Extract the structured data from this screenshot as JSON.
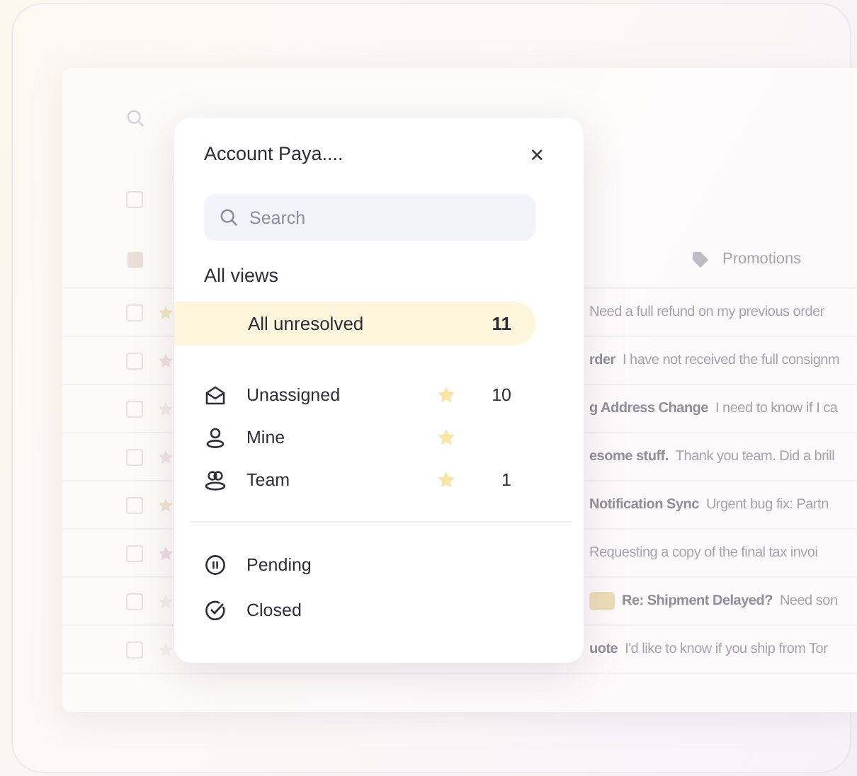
{
  "background_window": {
    "tab": {
      "label": "Promotions"
    },
    "rows": [
      {
        "subject": "",
        "preview": "Need a full refund on my previous order"
      },
      {
        "subject": "rder",
        "preview": "I have not received the full consignm"
      },
      {
        "subject": "g Address Change",
        "preview": "I need to know if I ca"
      },
      {
        "subject": "esome stuff.",
        "preview": "Thank you team. Did a brill"
      },
      {
        "subject": "Notification Sync",
        "preview": "Urgent bug fix: Partn"
      },
      {
        "subject": "",
        "preview": "Requesting a copy of the final tax invoi"
      },
      {
        "subject": "Re: Shipment Delayed?",
        "preview": "Need son",
        "tagged": true
      },
      {
        "subject": "uote",
        "preview": "I'd like to know if you ship from Tor"
      }
    ]
  },
  "popup": {
    "title": "Account Paya....",
    "close": "×",
    "search": {
      "placeholder": "Search"
    },
    "heading": "All views",
    "primary": {
      "label": "All unresolved",
      "count": "11",
      "selected": true
    },
    "views": [
      {
        "kind": "envelope",
        "label": "Unassigned",
        "starred": true,
        "count": "10",
        "selected": false
      },
      {
        "kind": "person",
        "label": "Mine",
        "starred": true,
        "selected": false
      },
      {
        "kind": "team",
        "label": "Team",
        "starred": true,
        "count": "1",
        "selected": false
      }
    ],
    "statuses": [
      {
        "kind": "pause",
        "label": "Pending",
        "selected": false
      },
      {
        "kind": "check",
        "label": "Closed",
        "selected": false
      }
    ]
  }
}
